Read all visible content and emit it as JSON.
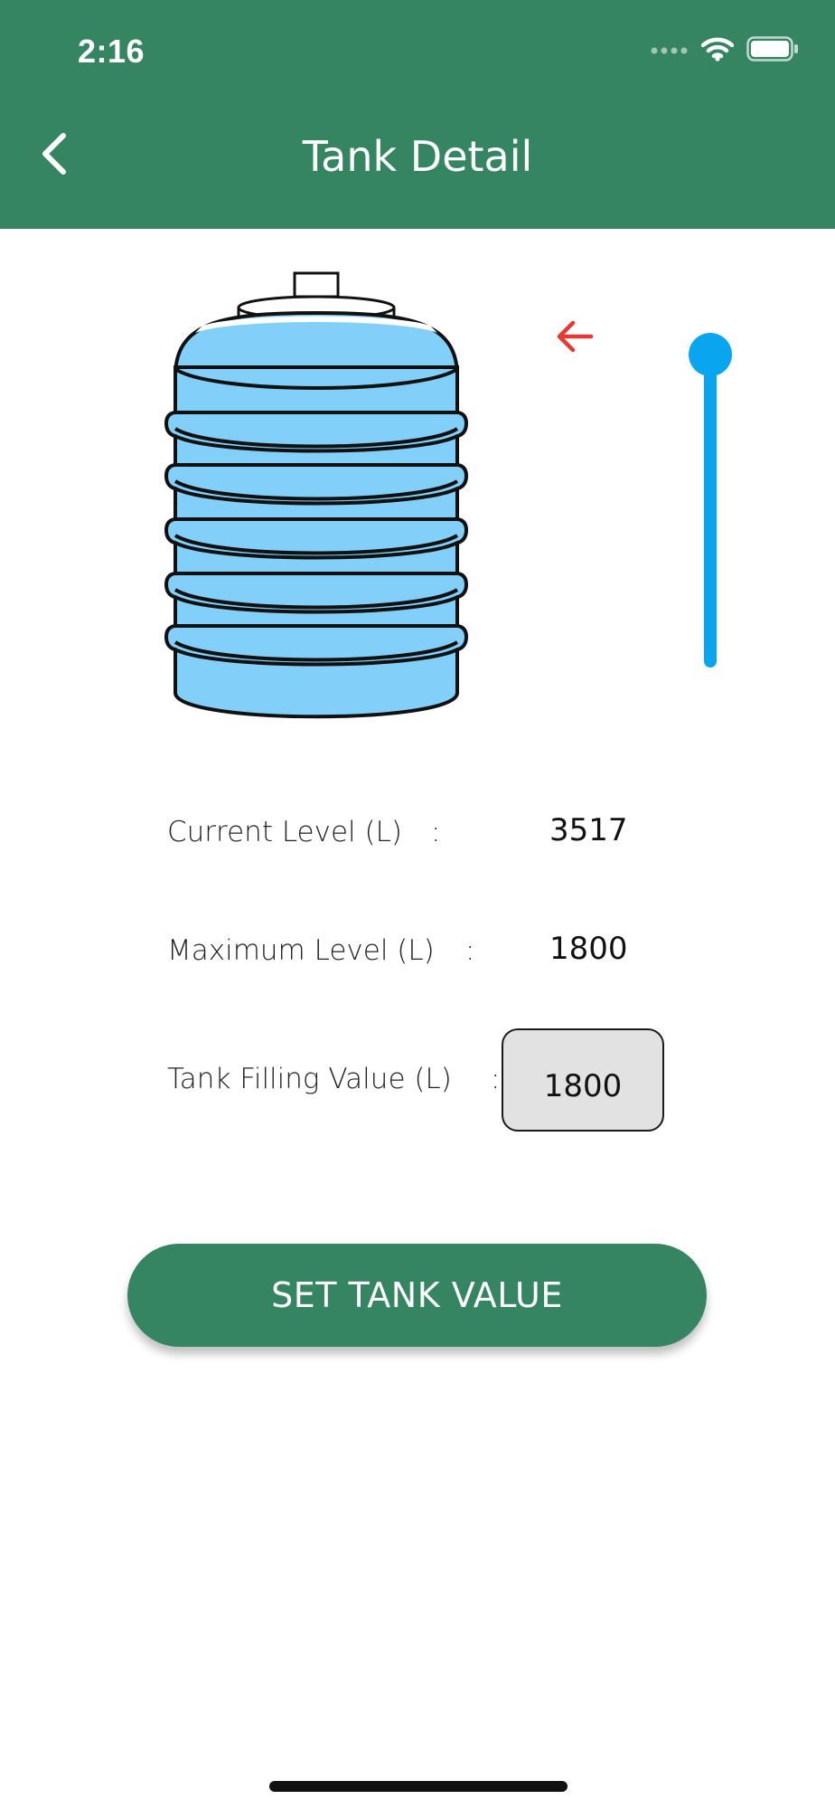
{
  "status_bar": {
    "time": "2:16",
    "icons": [
      "signal-icon",
      "wifi-icon",
      "battery-icon"
    ]
  },
  "header": {
    "title": "Tank Detail",
    "back_icon": "chevron-left-icon",
    "background_color": "#358563"
  },
  "tank": {
    "water_color": "#82d0fa",
    "level_indicator_icon": "arrow-left-icon",
    "level_indicator_color": "#e53935"
  },
  "slider": {
    "level_fraction": 1.0,
    "color": "#0aa5ef"
  },
  "info": {
    "current_level_label": "Current Level (L)",
    "current_level_value": "3517",
    "maximum_level_label": "Maximum Level (L)",
    "maximum_level_value": "1800",
    "filling_value_label": "Tank Filling Value (L)",
    "filling_value": "1800",
    "separator": ":"
  },
  "actions": {
    "set_button_label": "SET TANK VALUE"
  }
}
